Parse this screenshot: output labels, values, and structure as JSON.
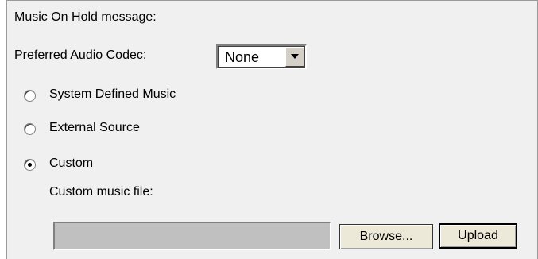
{
  "moh": {
    "title": "Music On Hold message:",
    "codec_label": "Preferred Audio Codec:",
    "codec_value": "None",
    "options": [
      {
        "label": "System Defined Music",
        "selected": false
      },
      {
        "label": "External Source",
        "selected": false
      },
      {
        "label": "Custom",
        "selected": true
      }
    ],
    "custom_file_label": "Custom music file:",
    "file_value": "",
    "browse_label": "Browse...",
    "upload_label": "Upload"
  },
  "icons": {
    "dropdown": "chevron-down-icon"
  }
}
